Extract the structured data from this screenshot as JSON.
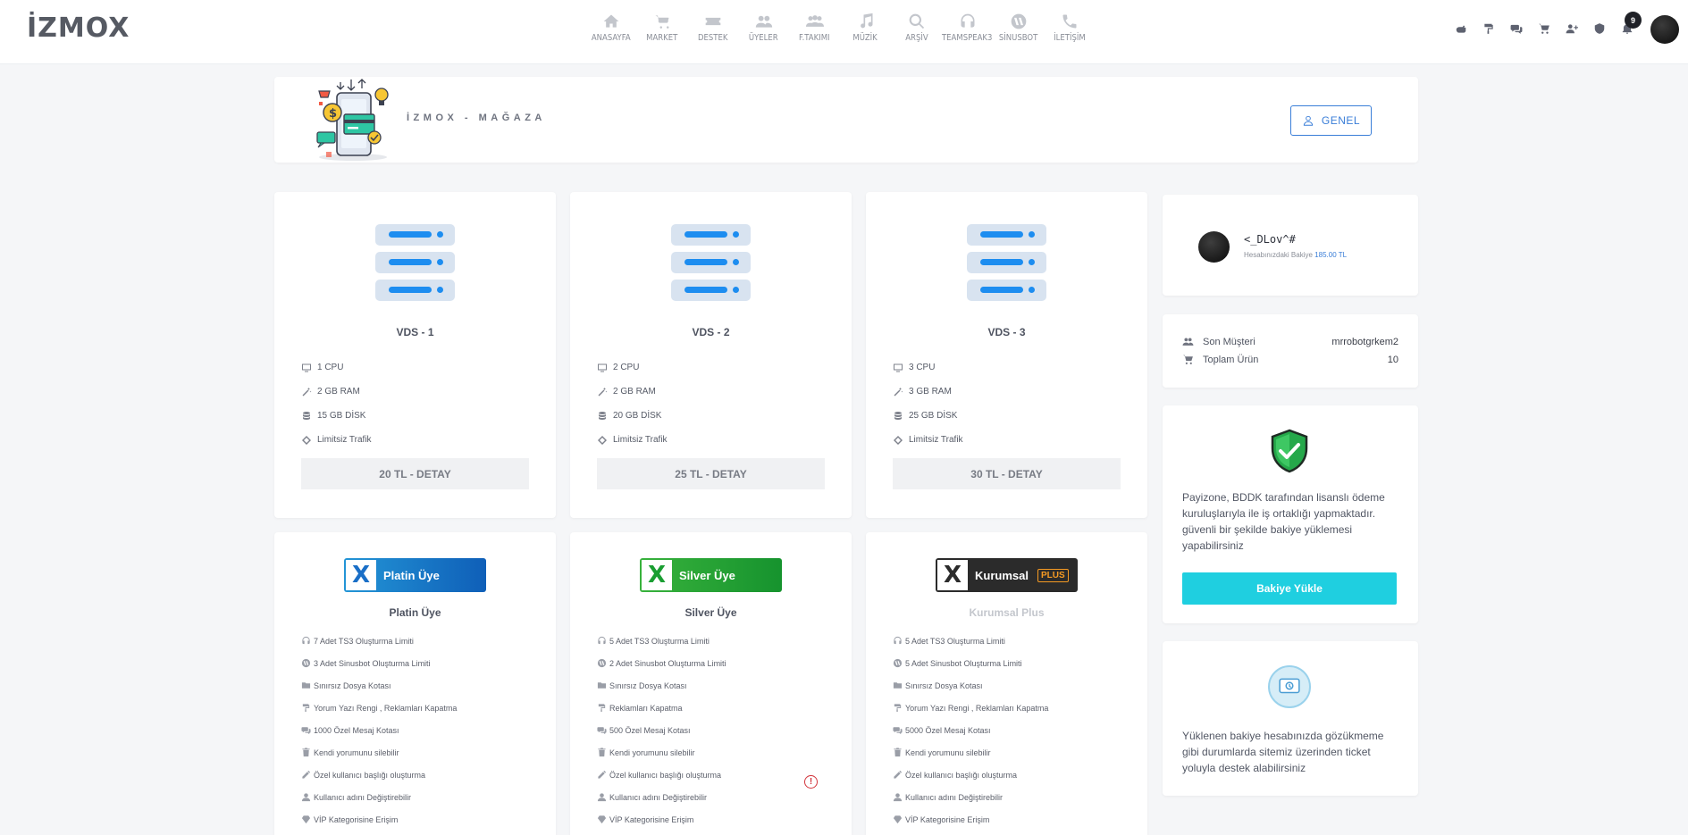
{
  "header": {
    "logo": "İZMOX",
    "nav": [
      {
        "label": "ANASAYFA",
        "icon": "home-icon"
      },
      {
        "label": "MARKET",
        "icon": "cart-icon"
      },
      {
        "label": "DESTEK",
        "icon": "ticket-icon"
      },
      {
        "label": "ÜYELER",
        "icon": "users-icon"
      },
      {
        "label": "F.TAKIMI",
        "icon": "team-icon"
      },
      {
        "label": "MÜZİK",
        "icon": "music-icon"
      },
      {
        "label": "ARŞİV",
        "icon": "search-icon"
      },
      {
        "label": "TEAMSPEAK3",
        "icon": "headset-icon"
      },
      {
        "label": "SİNUSBOT",
        "icon": "sinusbot-icon"
      },
      {
        "label": "İLETİŞİM",
        "icon": "phone-icon"
      }
    ],
    "notification_count": "9"
  },
  "banner": {
    "title": "İZMOX - MAĞAZA",
    "button": "GENEL"
  },
  "vds": [
    {
      "title": "VDS - 1",
      "cpu": "1 CPU",
      "ram": "2 GB RAM",
      "disk": "15 GB DİSK",
      "traffic": "Limitsiz Trafik",
      "button": "20 TL - DETAY"
    },
    {
      "title": "VDS - 2",
      "cpu": "2 CPU",
      "ram": "2 GB RAM",
      "disk": "20 GB DİSK",
      "traffic": "Limitsiz Trafik",
      "button": "25 TL - DETAY"
    },
    {
      "title": "VDS - 3",
      "cpu": "3 CPU",
      "ram": "3 GB RAM",
      "disk": "25 GB DİSK",
      "traffic": "Limitsiz Trafik",
      "button": "30 TL - DETAY"
    }
  ],
  "memberships": [
    {
      "badge": "Platin Üye",
      "title": "Platin Üye",
      "color": "#1a6fc7",
      "perks": [
        "7 Adet TS3 Oluşturma Limiti",
        "3 Adet Sinusbot Oluşturma Limiti",
        "Sınırsız Dosya Kotası",
        "Yorum Yazı Rengi , Reklamları Kapatma",
        "1000 Özel Mesaj Kotası",
        "Kendi yorumunu silebilir",
        "Özel kullanıcı başlığı oluşturma",
        "Kullanıcı adını Değiştirebilir",
        "VİP Kategorisine Erişim"
      ]
    },
    {
      "badge": "Silver Üye",
      "title": "Silver Üye",
      "color": "#1a9e32",
      "perks": [
        "5 Adet TS3 Oluşturma Limiti",
        "2 Adet Sinusbot Oluşturma Limiti",
        "Sınırsız Dosya Kotası",
        "Reklamları Kapatma",
        "500 Özel Mesaj Kotası",
        "Kendi yorumunu silebilir",
        "Özel kullanıcı başlığı oluşturma",
        "Kullanıcı adını Değiştirebilir",
        "VİP Kategorisine Erişim"
      ]
    },
    {
      "badge": "Kurumsal",
      "badge_tag": "PLUS",
      "title": "Kurumsal Plus",
      "color": "#2b2b2b",
      "perks": [
        "5 Adet TS3 Oluşturma Limiti",
        "5 Adet Sinusbot Oluşturma Limiti",
        "Sınırsız Dosya Kotası",
        "Yorum Yazı Rengi , Reklamları Kapatma",
        "5000 Özel Mesaj Kotası",
        "Kendi yorumunu silebilir",
        "Özel kullanıcı başlığı oluşturma",
        "Kullanıcı adını Değiştirebilir",
        "VİP Kategorisine Erişim"
      ]
    }
  ],
  "user": {
    "name": "<_DLov^#",
    "balance_label": "Hesabınızdaki Bakiye",
    "balance_value": "185.00 TL"
  },
  "stats": {
    "last_customer_label": "Son Müşteri",
    "last_customer_value": "mrrobotgrkem2",
    "total_products_label": "Toplam Ürün",
    "total_products_value": "10"
  },
  "payment": {
    "text": "Payizone, BDDK tarafından lisanslı ödeme kuruluşlarıyla ile iş ortaklığı yapmaktadır. güvenli bir şekilde bakiye yüklemesi yapabilirsiniz",
    "button": "Bakiye Yükle"
  },
  "support": {
    "text": "Yüklenen bakiye hesabınızda gözükmeme gibi durumlarda sitemiz üzerinden ticket yoluyla destek alabilirsiniz"
  },
  "warning_glyph": "!"
}
